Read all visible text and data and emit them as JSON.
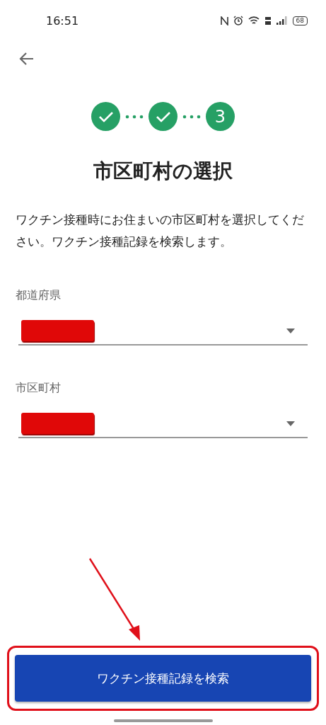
{
  "status_bar": {
    "time": "16:51",
    "battery": "68"
  },
  "steps": [
    {
      "kind": "done"
    },
    {
      "kind": "done"
    },
    {
      "kind": "current",
      "label": "3"
    }
  ],
  "title": "市区町村の選択",
  "description": "ワクチン接種時にお住まいの市区町村を選択してください。ワクチン接種記録を検索します。",
  "fields": [
    {
      "label": "都道府県",
      "redacted": true
    },
    {
      "label": "市区町村",
      "redacted": true
    }
  ],
  "button": {
    "label": "ワクチン接種記録を検索",
    "highlighted": true
  }
}
